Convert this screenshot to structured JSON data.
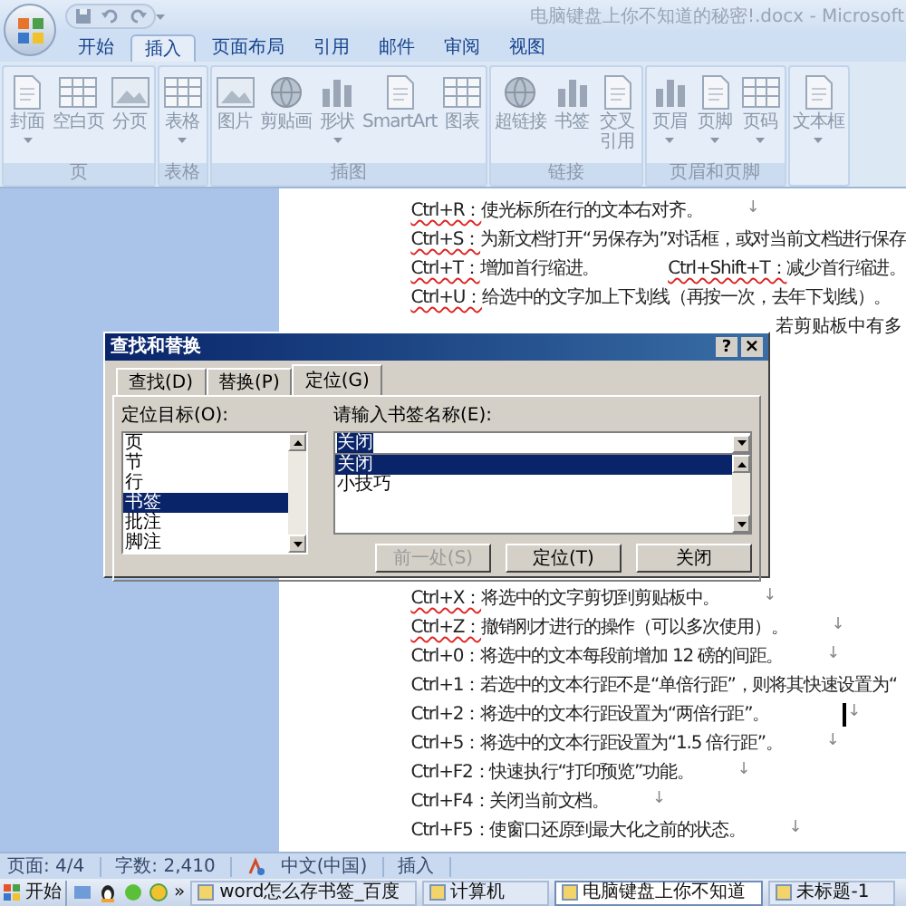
{
  "window": {
    "title": "电脑键盘上你不知道的秘密!.docx - Microsoft"
  },
  "ribbon_tabs": [
    {
      "label": "开始",
      "selected": false
    },
    {
      "label": "插入",
      "selected": true
    },
    {
      "label": "页面布局",
      "selected": false
    },
    {
      "label": "引用",
      "selected": false
    },
    {
      "label": "邮件",
      "selected": false
    },
    {
      "label": "审阅",
      "selected": false
    },
    {
      "label": "视图",
      "selected": false
    }
  ],
  "ribbon_groups": [
    {
      "label": "页",
      "buttons": [
        {
          "label": "封面",
          "dropdown": true
        },
        {
          "label": "空白页",
          "dropdown": false
        },
        {
          "label": "分页",
          "dropdown": false
        }
      ]
    },
    {
      "label": "表格",
      "buttons": [
        {
          "label": "表格",
          "dropdown": true
        }
      ]
    },
    {
      "label": "插图",
      "buttons": [
        {
          "label": "图片",
          "dropdown": false
        },
        {
          "label": "剪贴画",
          "dropdown": false
        },
        {
          "label": "形状",
          "dropdown": true
        },
        {
          "label": "SmartArt",
          "dropdown": false
        },
        {
          "label": "图表",
          "dropdown": false
        }
      ]
    },
    {
      "label": "链接",
      "buttons": [
        {
          "label": "超链接",
          "dropdown": false
        },
        {
          "label": "书签",
          "dropdown": false
        },
        {
          "label": "交叉引用",
          "dropdown": false,
          "wrap": true
        }
      ]
    },
    {
      "label": "页眉和页脚",
      "buttons": [
        {
          "label": "页眉",
          "dropdown": true
        },
        {
          "label": "页脚",
          "dropdown": true
        },
        {
          "label": "页码",
          "dropdown": true
        }
      ]
    },
    {
      "buttons": [
        {
          "label": "文本框",
          "dropdown": true
        }
      ]
    }
  ],
  "document": {
    "lines_top": [
      {
        "segments": [
          {
            "key": "Ctrl+R：",
            "squiggle": true,
            "text": "使光标所在行的文本右对齐。"
          }
        ],
        "mark": "↓",
        "caret": false
      },
      {
        "segments": [
          {
            "key": "Ctrl+S：",
            "squiggle": true,
            "text": "为新文档打开“另保存为”对话框，或对当前文档进行保存"
          }
        ],
        "caret": false
      },
      {
        "segments": [
          {
            "key": "Ctrl+T：",
            "squiggle": true,
            "text": "增加首行缩进。"
          },
          {
            "key": "Ctrl+Shift+T：",
            "squiggle": true,
            "text": "减少首行缩进。"
          }
        ],
        "caret": false
      },
      {
        "segments": [
          {
            "key": "Ctrl+U：",
            "squiggle": true,
            "text": "给选中的文字加上下划线（再按一次，去年下划线）。"
          }
        ],
        "caret": false
      }
    ],
    "partial_text": "若剪贴板中有多",
    "lines_bottom": [
      {
        "segments": [
          {
            "key": "Ctrl+X：",
            "squiggle": true,
            "text": "将选中的文字剪切到剪贴板中。"
          }
        ],
        "mark": "↓",
        "caret": false
      },
      {
        "segments": [
          {
            "key": "Ctrl+Z：",
            "squiggle": true,
            "text": "撤销刚才进行的操作（可以多次使用）。"
          }
        ],
        "mark": "↓",
        "caret": false
      },
      {
        "segments": [
          {
            "key": "Ctrl+0：",
            "squiggle": false,
            "text": "将选中的文本每段前增加 12 磅的间距。"
          }
        ],
        "mark": "↓",
        "caret": false
      },
      {
        "segments": [
          {
            "key": "Ctrl+1：",
            "squiggle": false,
            "text": "若选中的文本行距不是“单倍行距”，则将其快速设置为“"
          }
        ],
        "caret": false
      },
      {
        "segments": [
          {
            "key": "Ctrl+2：",
            "squiggle": false,
            "text": "将选中的文本行距设置为“两倍行距”。"
          }
        ],
        "mark": "↓",
        "caret": true
      },
      {
        "segments": [
          {
            "key": "Ctrl+5：",
            "squiggle": false,
            "text": "将选中的文本行距设置为“1.5 倍行距”。"
          }
        ],
        "mark": "↓",
        "caret": false
      },
      {
        "segments": [
          {
            "key": "Ctrl+F2：",
            "squiggle": false,
            "text": "快速执行“打印预览”功能。"
          }
        ],
        "mark": "↓",
        "caret": false
      },
      {
        "segments": [
          {
            "key": "Ctrl+F4：",
            "squiggle": false,
            "text": "关闭当前文档。"
          }
        ],
        "mark": "↓",
        "caret": false
      },
      {
        "segments": [
          {
            "key": "Ctrl+F5：",
            "squiggle": false,
            "text": "使窗口还原到最大化之前的状态。"
          }
        ],
        "mark": "↓",
        "caret": false
      }
    ]
  },
  "dialog": {
    "title": "查找和替换",
    "help": "?",
    "close": "×",
    "tabs": [
      {
        "label": "查找(D)",
        "selected": false
      },
      {
        "label": "替换(P)",
        "selected": false
      },
      {
        "label": "定位(G)",
        "selected": true
      }
    ],
    "target_label": "定位目标(O):",
    "targets": [
      {
        "label": "页",
        "selected": false
      },
      {
        "label": "节",
        "selected": false
      },
      {
        "label": "行",
        "selected": false
      },
      {
        "label": "书签",
        "selected": true
      },
      {
        "label": "批注",
        "selected": false
      },
      {
        "label": "脚注",
        "selected": false
      }
    ],
    "name_label": "请输入书签名称(E):",
    "name_value": "关闭",
    "names": [
      {
        "label": "关闭",
        "selected": true
      },
      {
        "label": "小技巧",
        "selected": false
      }
    ],
    "buttons": [
      {
        "label": "前一处(S)",
        "disabled": true
      },
      {
        "label": "定位(T)",
        "disabled": false
      },
      {
        "label": "关闭",
        "disabled": false
      }
    ]
  },
  "status_bar": {
    "page": "页面: 4/4",
    "words": "字数: 2,410",
    "language": "中文(中国)",
    "mode": "插入"
  },
  "taskbar": {
    "start": "开始",
    "more": "»",
    "tasks": [
      {
        "label": "word怎么存书签_百度",
        "selected": false
      },
      {
        "label": "计算机",
        "selected": false
      },
      {
        "label": "电脑键盘上你不知道",
        "selected": true
      },
      {
        "label": "未标题-1",
        "selected": false
      }
    ]
  }
}
